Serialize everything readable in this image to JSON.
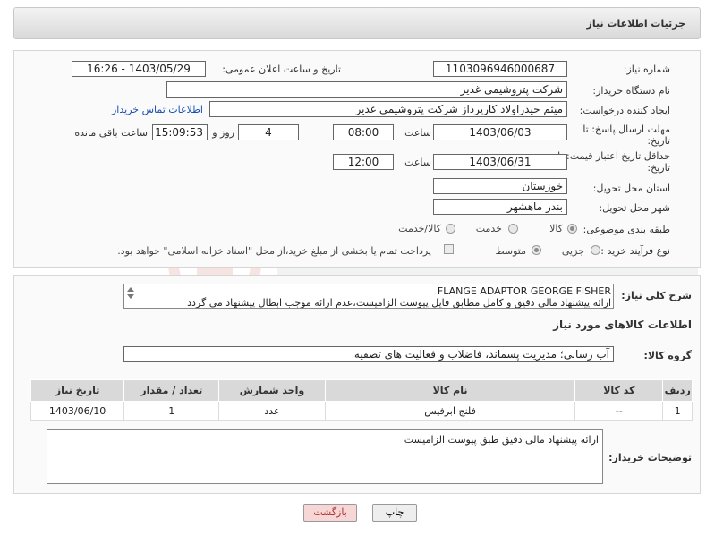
{
  "header": {
    "title": "جزئیات اطلاعات نیاز"
  },
  "form": {
    "need_number_label": "شماره نیاز:",
    "need_number": "1103096946000687",
    "announce_label": "تاریخ و ساعت اعلان عمومی:",
    "announce_value": "1403/05/29 - 16:26",
    "buyer_org_label": "نام دستگاه خریدار:",
    "buyer_org": "شرکت پتروشیمی غدیر",
    "creator_label": "ایجاد کننده درخواست:",
    "creator": "میثم حیدراولاد کارپرداز شرکت پتروشیمی غدیر",
    "contact_link": "اطلاعات تماس خریدار",
    "deadline_label_1": "مهلت ارسال پاسخ: تا",
    "deadline_label_2": "تاریخ:",
    "deadline_date": "1403/06/03",
    "time_label": "ساعت",
    "deadline_time": "08:00",
    "days_value": "4",
    "days_label": "روز و",
    "remaining_time": "15:09:53",
    "remaining_label": "ساعت باقی مانده",
    "validity_label_1": "حداقل تاریخ اعتبار قیمت: تا",
    "validity_label_2": "تاریخ:",
    "validity_date": "1403/06/31",
    "validity_time": "12:00",
    "province_label": "استان محل تحویل:",
    "province": "خوزستان",
    "city_label": "شهر محل تحویل:",
    "city": "بندر ماهشهر",
    "category_label": "طبقه بندی موضوعی:",
    "category_options": [
      "کالا",
      "خدمت",
      "کالا/خدمت"
    ],
    "purchase_type_label": "نوع فرآیند خرید :",
    "purchase_options": [
      "جزیی",
      "متوسط"
    ],
    "payment_note": "پرداخت تمام یا بخشی از مبلغ خرید،از محل \"اسناد خزانه اسلامی\" خواهد بود."
  },
  "general": {
    "desc_label": "شرح کلی نیاز:",
    "desc_line1": "FLANGE ADAPTOR GEORGE FISHER",
    "desc_line2": "ارائه پیشنهاد مالی دقیق و کامل مطابق فایل پیوست الزامیست،عدم ارائه موجب ابطال پیشنهاد می گردد",
    "goods_info_title": "اطلاعات کالاهای مورد نیاز",
    "goods_group_label": "گروه کالا:",
    "goods_group": "آب رسانی؛ مدیریت پسماند، فاضلاب و فعالیت های تصفیه"
  },
  "table": {
    "headers": [
      "ردیف",
      "کد کالا",
      "نام کالا",
      "واحد شمارش",
      "تعداد / مقدار",
      "تاریخ نیاز"
    ],
    "rows": [
      [
        "1",
        "--",
        "فلنج ابرفیس",
        "عدد",
        "1",
        "1403/06/10"
      ]
    ]
  },
  "buyer_notes": {
    "label": "توضیحات خریدار:",
    "text": "ارائه پیشنهاد مالی دقیق طبق پیوست الزامیست"
  },
  "buttons": {
    "print": "چاپ",
    "back": "بازگشت"
  },
  "colors": {
    "link": "#1a4fb5",
    "back_button": "#f7d6d6",
    "print_button": "#eeeeee"
  }
}
